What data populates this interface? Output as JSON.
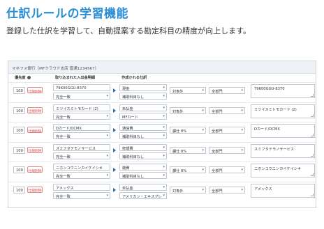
{
  "page": {
    "title": "仕訳ルールの学習機能",
    "subtitle": "登録した仕訳を学習して、自動提案する勘定科目の精度が向上します。"
  },
  "panel": {
    "header": "マネフォ銀行（MFクラウド支店 普通1234567）",
    "columns": {
      "priority": "優先度",
      "source": "取り込まれた入出金明細",
      "journal": "作成される仕訳"
    },
    "delete_label": "仕組削除",
    "rows": [
      {
        "priority": "100",
        "description": "79K00GGU-8370",
        "match": "完全一致",
        "account": "現金",
        "sub_account": "補助科目なし",
        "tax": "対象外",
        "department": "全部門",
        "memo": "79K00GGU-8370"
      },
      {
        "priority": "100",
        "description": "ミツイスミトモカード (2)",
        "match": "完全一致",
        "account": "未払金",
        "sub_account": "MFカード",
        "tax": "対象外",
        "department": "全部門",
        "memo": "ミツイスミトモカード (2)"
      },
      {
        "priority": "100",
        "description": "Dカード/DCMX",
        "match": "完全一致",
        "account": "通信費",
        "sub_account": "補助科目なし",
        "tax": "課仕 8%",
        "department": "全部門",
        "memo": "Dカード/DCMX"
      },
      {
        "priority": "100",
        "description": "スミフタテモノサービス",
        "match": "完全一致",
        "account": "修繕費",
        "sub_account": "補助科目なし",
        "tax": "課仕 8%",
        "department": "全部門",
        "memo": "スミフタテモノサービス"
      },
      {
        "priority": "100",
        "description": "ニホンコウニンカイケイシキ",
        "match": "完全一致",
        "account": "雑費",
        "sub_account": "補助科目なし",
        "tax": "課仕 8%",
        "department": "全部門",
        "memo": "ニホンコウニンカイケイシキ"
      },
      {
        "priority": "100",
        "description": "アメックス",
        "match": "完全一致",
        "account": "未払金",
        "sub_account": "アメリカン・エキスプレ",
        "tax": "対象外",
        "department": "全部門",
        "memo": "アメックス"
      }
    ]
  },
  "colors": {
    "title": "#2a8fd6",
    "delete_button": "#d24a4a",
    "arrow": "#2a6fb5"
  }
}
